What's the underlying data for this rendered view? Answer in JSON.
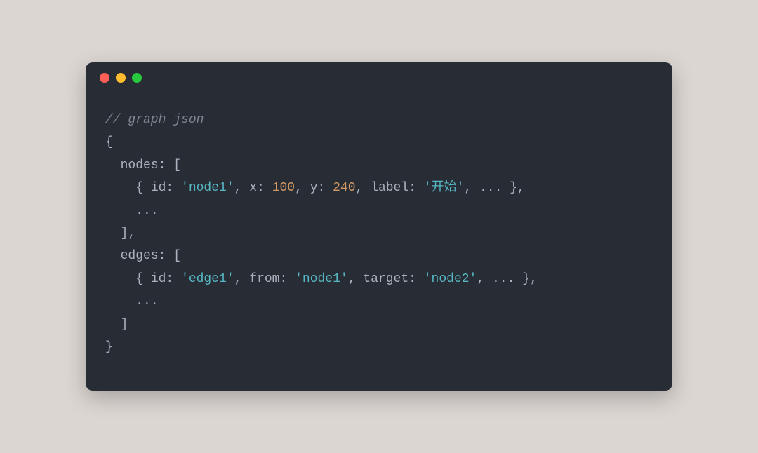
{
  "code": {
    "comment": "// graph json",
    "open_brace": "{",
    "nodes_key": "nodes",
    "nodes_open": ": [",
    "node_line": {
      "open": "    { ",
      "id_key": "id",
      "id_sep": ": ",
      "id_val": "'node1'",
      "c1": ", ",
      "x_key": "x",
      "x_sep": ": ",
      "x_val": "100",
      "c2": ", ",
      "y_key": "y",
      "y_sep": ": ",
      "y_val": "240",
      "c3": ", ",
      "label_key": "label",
      "label_sep": ": ",
      "label_val": "'开始'",
      "c4": ", ",
      "ellipsis": "...",
      "close": " },"
    },
    "nodes_ellipsis": "    ...",
    "nodes_close": "  ],",
    "edges_key": "edges",
    "edges_open": ": [",
    "edge_line": {
      "open": "    { ",
      "id_key": "id",
      "id_sep": ": ",
      "id_val": "'edge1'",
      "c1": ", ",
      "from_key": "from",
      "from_sep": ": ",
      "from_val": "'node1'",
      "c2": ", ",
      "target_key": "target",
      "target_sep": ": ",
      "target_val": "'node2'",
      "c3": ", ",
      "ellipsis": "...",
      "close": " },"
    },
    "edges_ellipsis": "    ...",
    "edges_close": "  ]",
    "close_brace": "}"
  },
  "colors": {
    "red": "#ff5f56",
    "yellow": "#ffbd2e",
    "green": "#27c93f",
    "background": "#282c34"
  }
}
